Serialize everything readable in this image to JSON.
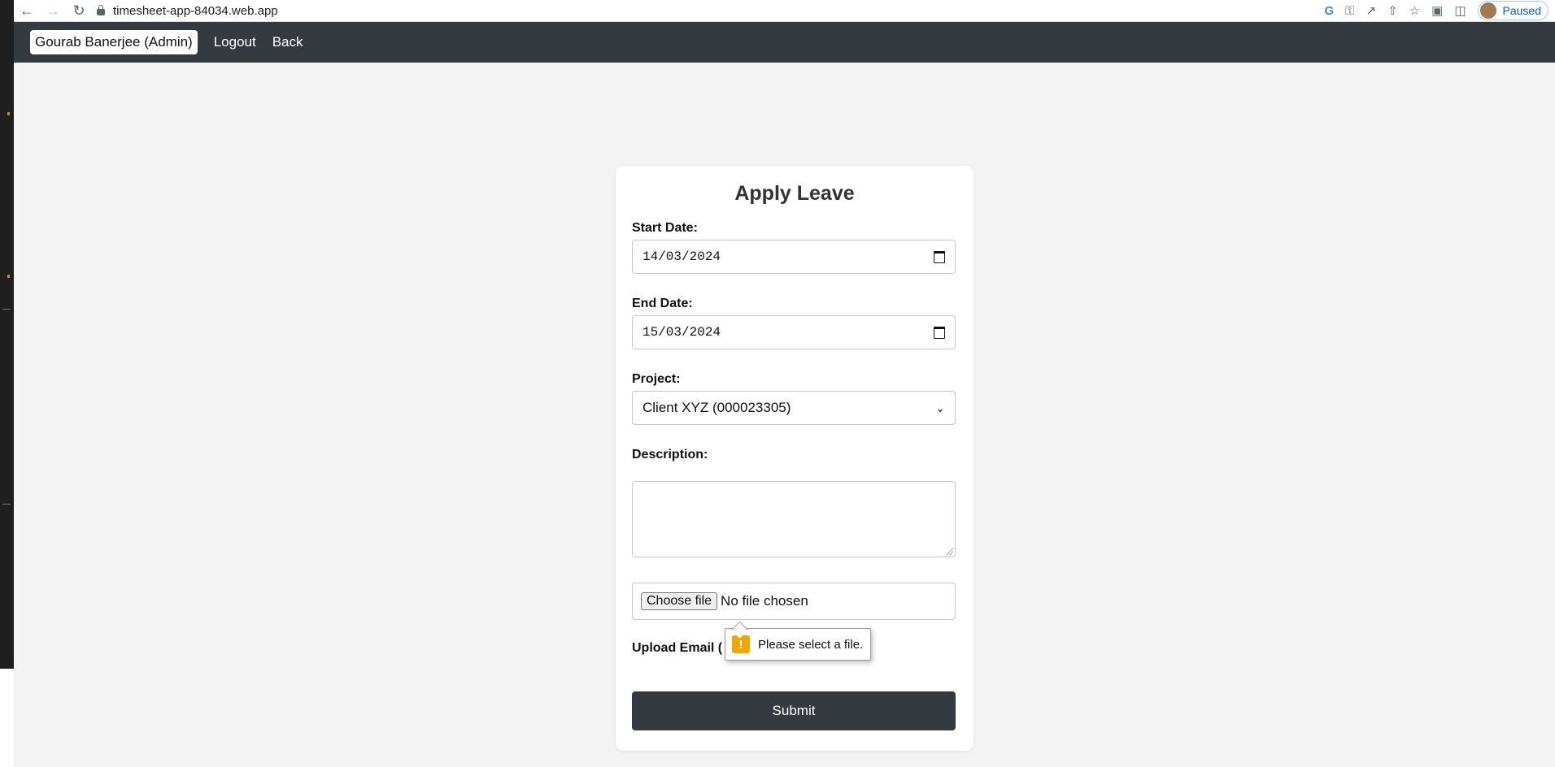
{
  "browser": {
    "url": "timesheet-app-84034.web.app",
    "profile_status": "Paused",
    "icons": {
      "back": "arrow-left-icon",
      "forward": "arrow-right-icon",
      "reload": "reload-icon",
      "lock": "lock-icon",
      "google": "google-icon",
      "key": "key-icon",
      "open_in_app": "open-in-app-icon",
      "share": "share-icon",
      "bookmark": "star-icon",
      "extensions": "puzzle-icon",
      "side_panel": "side-panel-icon"
    }
  },
  "navbar": {
    "user": "Gourab Banerjee (Admin)",
    "logout": "Logout",
    "back": "Back",
    "bg_color": "#343a40"
  },
  "form": {
    "title": "Apply Leave",
    "start_date": {
      "label": "Start Date:",
      "value": "14/03/2024"
    },
    "end_date": {
      "label": "End Date:",
      "value": "15/03/2024"
    },
    "project": {
      "label": "Project:",
      "value": "Client XYZ (000023305)"
    },
    "description": {
      "label": "Description:",
      "value": ""
    },
    "file": {
      "button": "Choose file",
      "status": "No file chosen"
    },
    "upload_label": "Upload Email (",
    "validation_message": "Please select a file.",
    "submit": "Submit"
  }
}
